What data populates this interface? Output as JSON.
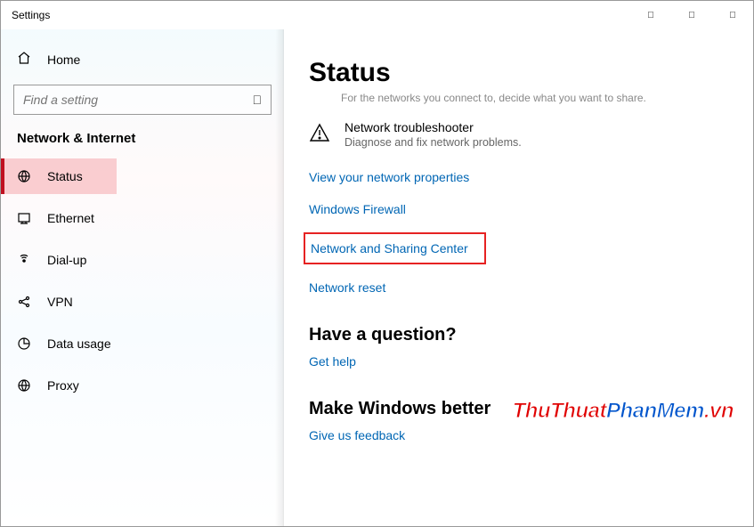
{
  "titlebar": {
    "title": "Settings"
  },
  "sidebar": {
    "home": "Home",
    "search_placeholder": "Find a setting",
    "section": "Network & Internet",
    "items": [
      {
        "label": "Status"
      },
      {
        "label": "Ethernet"
      },
      {
        "label": "Dial-up"
      },
      {
        "label": "VPN"
      },
      {
        "label": "Data usage"
      },
      {
        "label": "Proxy"
      }
    ]
  },
  "content": {
    "title": "Status",
    "subtext": "For the networks you connect to, decide what you want to share.",
    "troubleshooter": {
      "title": "Network troubleshooter",
      "sub": "Diagnose and fix network problems."
    },
    "links": {
      "view_props": "View your network properties",
      "firewall": "Windows Firewall",
      "sharing_center": "Network and Sharing Center",
      "reset": "Network reset"
    },
    "question_heading": "Have a question?",
    "get_help": "Get help",
    "better_heading": "Make Windows better",
    "feedback": "Give us feedback"
  },
  "watermark": {
    "part1": "ThuThuat",
    "part2": "PhanMem",
    "part3": ".vn"
  }
}
